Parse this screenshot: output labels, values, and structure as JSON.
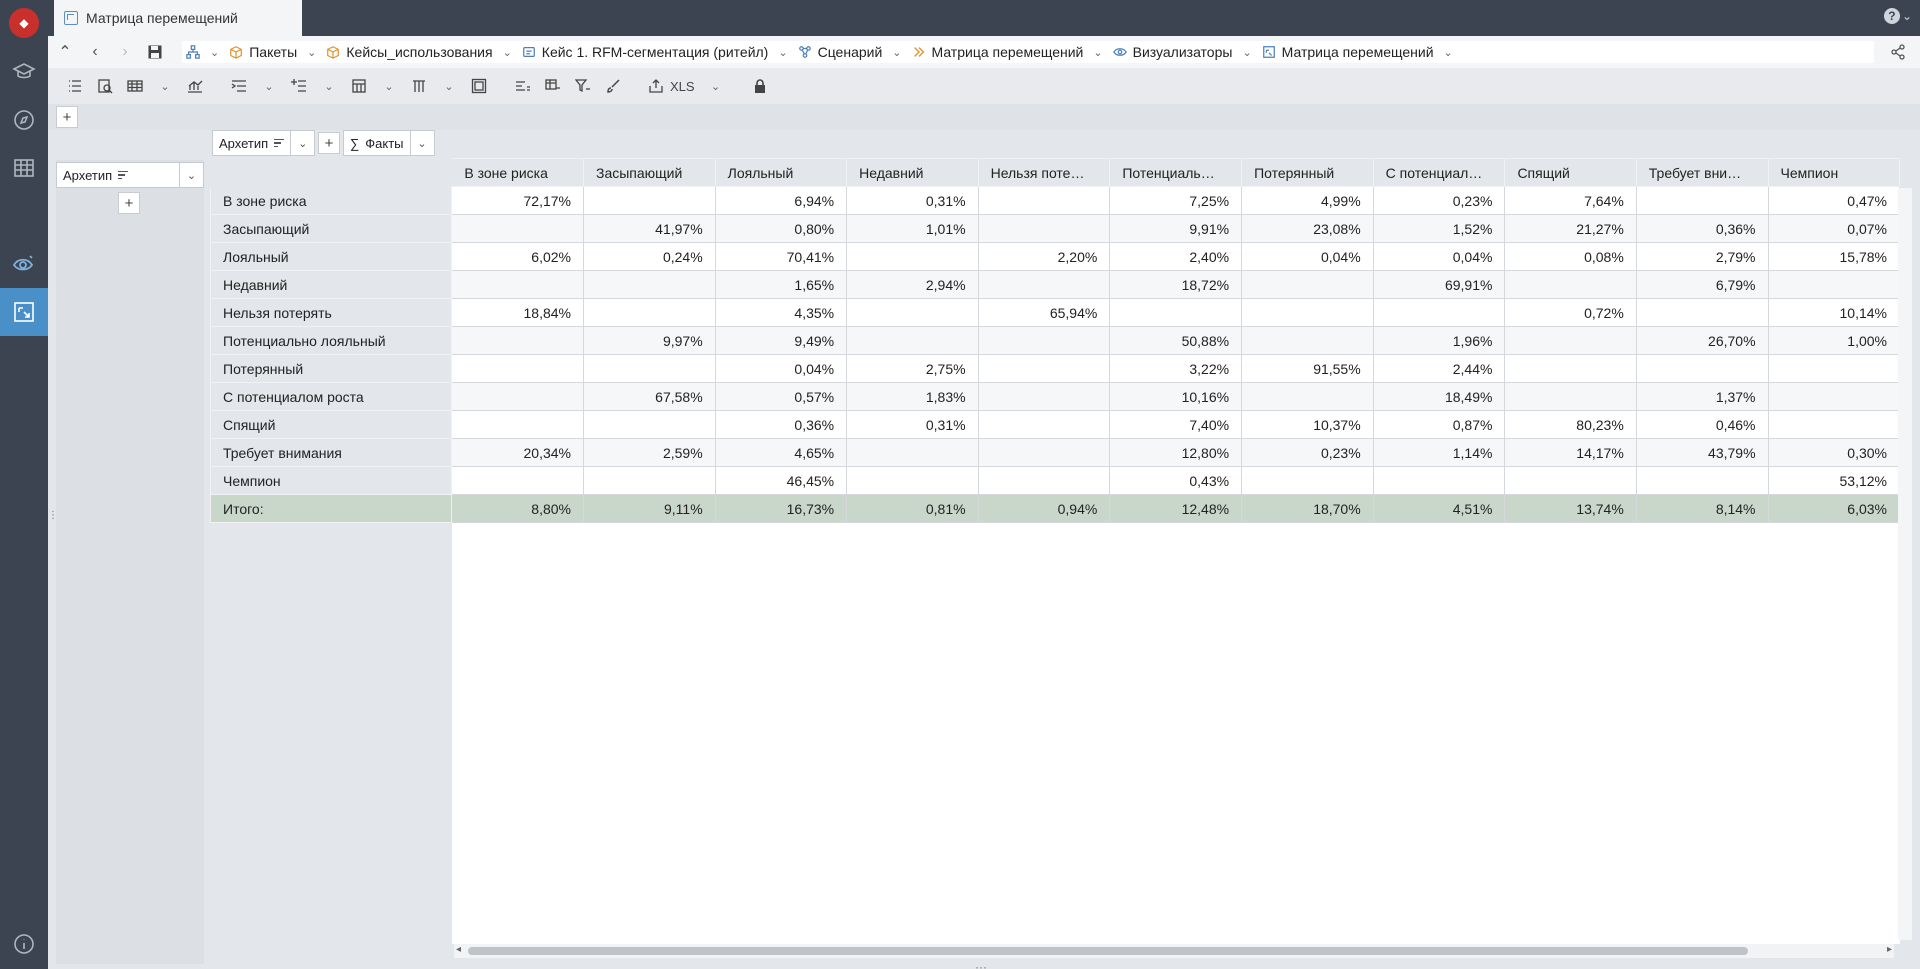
{
  "tab": {
    "title": "Матрица перемещений"
  },
  "breadcrumbs": [
    {
      "label": "Пакеты"
    },
    {
      "label": "Кейсы_использования"
    },
    {
      "label": "Кейс 1. RFM-сегментация (ритейл)"
    },
    {
      "label": "Сценарий"
    },
    {
      "label": "Матрица перемещений"
    },
    {
      "label": "Визуализаторы"
    },
    {
      "label": "Матрица перемещений"
    }
  ],
  "toolbar": {
    "xls_label": "XLS"
  },
  "pivot_controls": {
    "column_dim": "Архетип",
    "facts": "Факты",
    "row_dim": "Архетип",
    "add": "+"
  },
  "columns": [
    "В зоне риска",
    "Засыпающий",
    "Лояльный",
    "Недавний",
    "Нельзя поте…",
    "Потенциаль…",
    "Потерянный",
    "С потенциал…",
    "Спящий",
    "Требует вни…",
    "Чемпион"
  ],
  "rows": [
    {
      "label": "В зоне риска",
      "values": [
        "72,17%",
        "",
        "6,94%",
        "0,31%",
        "",
        "7,25%",
        "4,99%",
        "0,23%",
        "7,64%",
        "",
        "0,47%"
      ]
    },
    {
      "label": "Засыпающий",
      "values": [
        "",
        "41,97%",
        "0,80%",
        "1,01%",
        "",
        "9,91%",
        "23,08%",
        "1,52%",
        "21,27%",
        "0,36%",
        "0,07%"
      ]
    },
    {
      "label": "Лояльный",
      "values": [
        "6,02%",
        "0,24%",
        "70,41%",
        "",
        "2,20%",
        "2,40%",
        "0,04%",
        "0,04%",
        "0,08%",
        "2,79%",
        "15,78%"
      ]
    },
    {
      "label": "Недавний",
      "values": [
        "",
        "",
        "1,65%",
        "2,94%",
        "",
        "18,72%",
        "",
        "69,91%",
        "",
        "6,79%",
        ""
      ]
    },
    {
      "label": "Нельзя потерять",
      "values": [
        "18,84%",
        "",
        "4,35%",
        "",
        "65,94%",
        "",
        "",
        "",
        "0,72%",
        "",
        "10,14%"
      ]
    },
    {
      "label": "Потенциально лояльный",
      "values": [
        "",
        "9,97%",
        "9,49%",
        "",
        "",
        "50,88%",
        "",
        "1,96%",
        "",
        "26,70%",
        "1,00%"
      ]
    },
    {
      "label": "Потерянный",
      "values": [
        "",
        "",
        "0,04%",
        "2,75%",
        "",
        "3,22%",
        "91,55%",
        "2,44%",
        "",
        "",
        ""
      ]
    },
    {
      "label": "С потенциалом роста",
      "values": [
        "",
        "67,58%",
        "0,57%",
        "1,83%",
        "",
        "10,16%",
        "",
        "18,49%",
        "",
        "1,37%",
        ""
      ]
    },
    {
      "label": "Спящий",
      "values": [
        "",
        "",
        "0,36%",
        "0,31%",
        "",
        "7,40%",
        "10,37%",
        "0,87%",
        "80,23%",
        "0,46%",
        ""
      ]
    },
    {
      "label": "Требует внимания",
      "values": [
        "20,34%",
        "2,59%",
        "4,65%",
        "",
        "",
        "12,80%",
        "0,23%",
        "1,14%",
        "14,17%",
        "43,79%",
        "0,30%"
      ]
    },
    {
      "label": "Чемпион",
      "values": [
        "",
        "",
        "46,45%",
        "",
        "",
        "0,43%",
        "",
        "",
        "",
        "",
        "53,12%"
      ]
    }
  ],
  "total": {
    "label": "Итого:",
    "values": [
      "8,80%",
      "9,11%",
      "16,73%",
      "0,81%",
      "0,94%",
      "12,48%",
      "18,70%",
      "4,51%",
      "13,74%",
      "8,14%",
      "6,03%"
    ]
  },
  "colors": {
    "rail": "#3b4450",
    "active": "#4a90c8",
    "total_row": "#c9d7cb"
  }
}
